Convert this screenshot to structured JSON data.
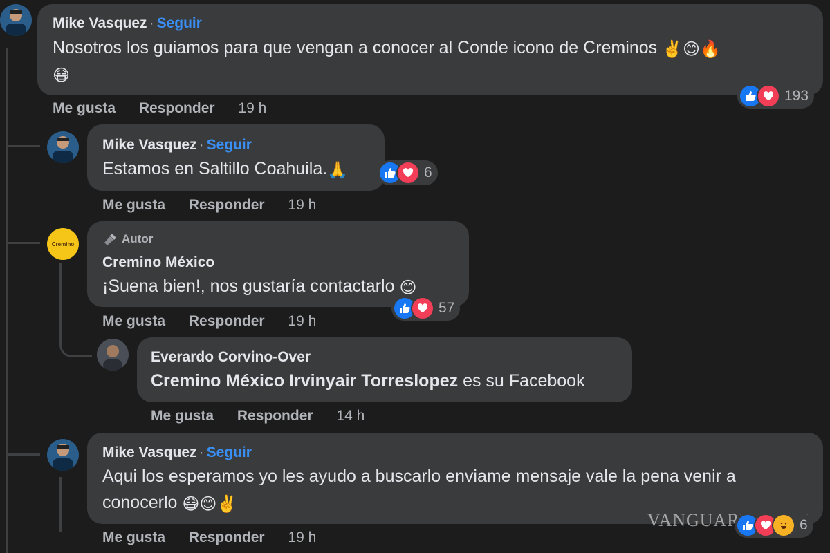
{
  "comments": [
    {
      "author": "Mike Vasquez",
      "follow": "Seguir",
      "text": "Nosotros los guiamos para que vengan a conocer al Conde icono de Creminos",
      "emojis_line1": [
        "✌️",
        "😊",
        "🔥"
      ],
      "emojis_line2": [
        "😷"
      ],
      "like": "Me gusta",
      "reply": "Responder",
      "time": "19 h",
      "reaction_count": "193",
      "reactions": [
        "like-icon",
        "love-icon"
      ]
    },
    {
      "author": "Mike Vasquez",
      "follow": "Seguir",
      "text": "Estamos en Saltillo Coahuila.",
      "emojis": [
        "🙏"
      ],
      "like": "Me gusta",
      "reply": "Responder",
      "time": "19 h",
      "reaction_count": "6",
      "reactions": [
        "like-icon",
        "love-icon"
      ]
    },
    {
      "badge": "Autor",
      "author": "Cremino México",
      "avatar_text": "Cremino",
      "text": "¡Suena bien!, nos gustaría contactarlo",
      "emojis": [
        "😊"
      ],
      "like": "Me gusta",
      "reply": "Responder",
      "time": "19 h",
      "reaction_count": "57",
      "reactions": [
        "like-icon",
        "love-icon"
      ]
    },
    {
      "author": "Everardo Corvino-Over",
      "mention": "Cremino México Irvinyair Torreslopez",
      "text": "es su Facebook",
      "like": "Me gusta",
      "reply": "Responder",
      "time": "14 h"
    },
    {
      "author": "Mike Vasquez",
      "follow": "Seguir",
      "text_line1": "Aqui los esperamos yo les ayudo a buscarlo enviame mensaje vale la pena venir a",
      "text_line2": "conocerlo",
      "emojis": [
        "😷",
        "😊",
        "✌️"
      ],
      "like": "Me gusta",
      "reply": "Responder",
      "time": "19 h",
      "reaction_count": "6",
      "reactions": [
        "like-icon",
        "love-icon",
        "haha-icon"
      ]
    }
  ],
  "watermark": "VANGUARDIA.MX",
  "colors": {
    "background": "#1c1c1d",
    "bubble": "#3a3b3c",
    "link": "#3a8ff5",
    "like": "#1877f2",
    "love": "#f33e58"
  }
}
